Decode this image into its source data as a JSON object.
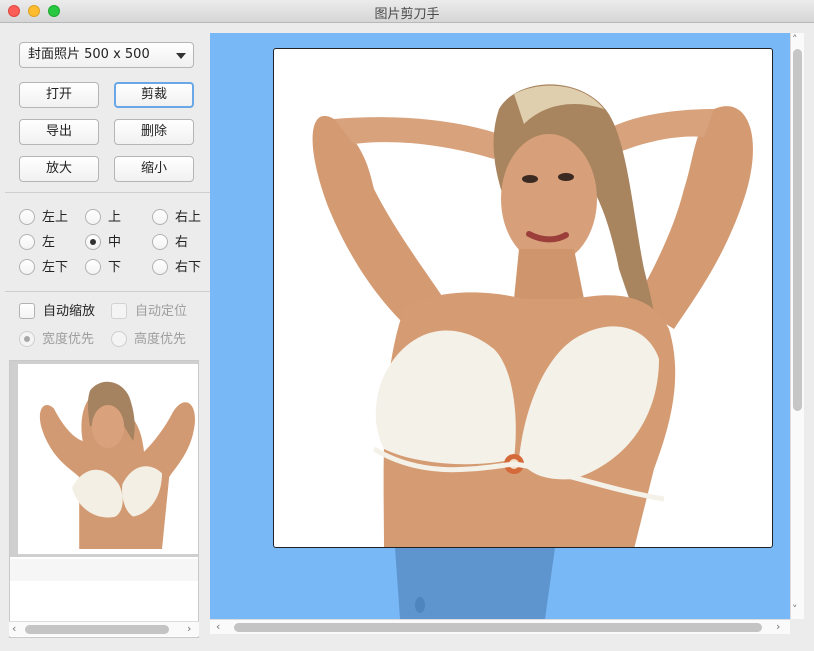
{
  "window": {
    "title": "图片剪刀手"
  },
  "controls": {
    "preset_select": "封面照片 500 x 500",
    "buttons": {
      "open": "打开",
      "crop": "剪裁",
      "export": "导出",
      "delete": "删除",
      "zoom_in": "放大",
      "zoom_out": "缩小"
    },
    "anchors": [
      {
        "label": "左上",
        "selected": false
      },
      {
        "label": "上",
        "selected": false
      },
      {
        "label": "右上",
        "selected": false
      },
      {
        "label": "左",
        "selected": false
      },
      {
        "label": "中",
        "selected": true
      },
      {
        "label": "右",
        "selected": false
      },
      {
        "label": "左下",
        "selected": false
      },
      {
        "label": "下",
        "selected": false
      },
      {
        "label": "右下",
        "selected": false
      }
    ],
    "auto_scale": {
      "label": "自动缩放",
      "checked": false
    },
    "auto_position": {
      "label": "自动定位",
      "checked": false,
      "disabled": true
    },
    "priority": [
      {
        "label": "宽度优先",
        "selected": true,
        "disabled": true
      },
      {
        "label": "高度优先",
        "selected": false,
        "disabled": true
      }
    ]
  },
  "colors": {
    "canvas_background": "#79b8f7",
    "focus_ring": "#6aa7e6"
  },
  "icons": {
    "dropdown": "chevron-down-icon",
    "scroll_left": "scroll-left-arrow-icon",
    "scroll_right": "scroll-right-arrow-icon",
    "scroll_up": "scroll-up-arrow-icon",
    "scroll_down": "scroll-down-arrow-icon"
  }
}
